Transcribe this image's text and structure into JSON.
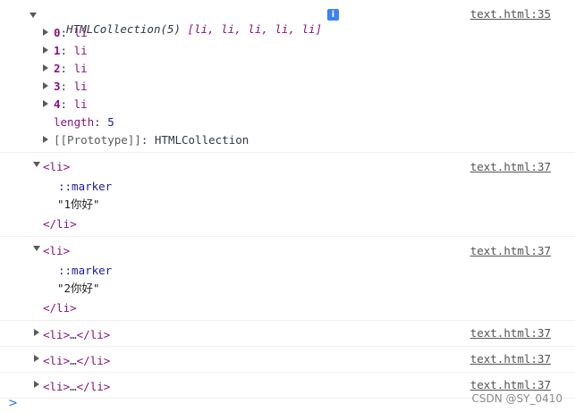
{
  "entry1": {
    "header_collection": "HTMLCollection(5)",
    "header_items": "[li, li, li, li, li]",
    "info_badge": "i",
    "source": "text.html:35",
    "items": [
      {
        "key": "0",
        "value": "li"
      },
      {
        "key": "1",
        "value": "li"
      },
      {
        "key": "2",
        "value": "li"
      },
      {
        "key": "3",
        "value": "li"
      },
      {
        "key": "4",
        "value": "li"
      }
    ],
    "length_key": "length",
    "length_value": "5",
    "prototype_key": "[[Prototype]]",
    "prototype_value": "HTMLCollection"
  },
  "entry2": {
    "open_tag": "<li>",
    "pseudo": "::marker",
    "text": "\"1你好\"",
    "close_tag": "</li>",
    "source": "text.html:37"
  },
  "entry3": {
    "open_tag": "<li>",
    "pseudo": "::marker",
    "text": "\"2你好\"",
    "close_tag": "</li>",
    "source": "text.html:37"
  },
  "collapsed": [
    {
      "open_tag": "<li>",
      "ellipsis": "…",
      "close_tag": "</li>",
      "source": "text.html:37"
    },
    {
      "open_tag": "<li>",
      "ellipsis": "…",
      "close_tag": "</li>",
      "source": "text.html:37"
    },
    {
      "open_tag": "<li>",
      "ellipsis": "…",
      "close_tag": "</li>",
      "source": "text.html:37"
    }
  ],
  "prompt_symbol": ">",
  "watermark": "CSDN @SY_0410"
}
